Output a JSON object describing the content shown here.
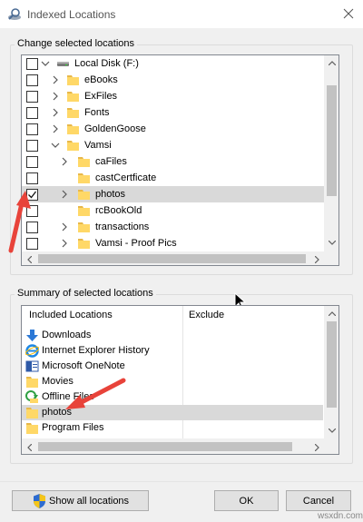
{
  "window": {
    "title": "Indexed Locations",
    "icon": "search-magnifier-icon"
  },
  "change_group": {
    "label": "Change selected locations",
    "tree": [
      {
        "label": "Local Disk (F:)",
        "checked": false,
        "expander": "expanded",
        "icon": "drive-icon"
      },
      {
        "label": "eBooks",
        "checked": false,
        "expander": "collapsed",
        "icon": "folder-icon"
      },
      {
        "label": "ExFiles",
        "checked": false,
        "expander": "collapsed",
        "icon": "folder-icon"
      },
      {
        "label": "Fonts",
        "checked": false,
        "expander": "collapsed",
        "icon": "folder-icon"
      },
      {
        "label": "GoldenGoose",
        "checked": false,
        "expander": "collapsed",
        "icon": "folder-icon"
      },
      {
        "label": "Vamsi",
        "checked": false,
        "expander": "expanded",
        "icon": "folder-icon"
      },
      {
        "label": "caFiles",
        "checked": false,
        "expander": "collapsed",
        "icon": "folder-icon"
      },
      {
        "label": "castCertficate",
        "checked": false,
        "expander": "none",
        "icon": "folder-icon"
      },
      {
        "label": "photos",
        "checked": true,
        "expander": "collapsed",
        "icon": "folder-icon",
        "selected": true
      },
      {
        "label": "rcBookOld",
        "checked": false,
        "expander": "none",
        "icon": "folder-icon"
      },
      {
        "label": "transactions",
        "checked": false,
        "expander": "collapsed",
        "icon": "folder-icon"
      },
      {
        "label": "Vamsi - Proof Pics",
        "checked": false,
        "expander": "collapsed",
        "icon": "folder-icon"
      }
    ]
  },
  "summary_group": {
    "label": "Summary of selected locations",
    "columns": [
      "Included Locations",
      "Exclude"
    ],
    "rows": [
      {
        "label": "Downloads",
        "icon": "downloads-arrow-icon"
      },
      {
        "label": "Internet Explorer History",
        "icon": "internet-explorer-icon"
      },
      {
        "label": "Microsoft OneNote",
        "icon": "onenote-icon"
      },
      {
        "label": "Movies",
        "icon": "folder-icon"
      },
      {
        "label": "Offline Files",
        "icon": "offline-files-icon"
      },
      {
        "label": "photos",
        "icon": "folder-icon",
        "selected": true
      },
      {
        "label": "Program Files",
        "icon": "folder-icon"
      }
    ]
  },
  "buttons": {
    "show_all": "Show all locations",
    "ok": "OK",
    "cancel": "Cancel"
  },
  "watermark": "wsxdn.com",
  "colors": {
    "selection": "#d9d9d9",
    "folder": "#ffd867",
    "annotation_arrow": "#e8433a",
    "title_text": "#555555"
  }
}
